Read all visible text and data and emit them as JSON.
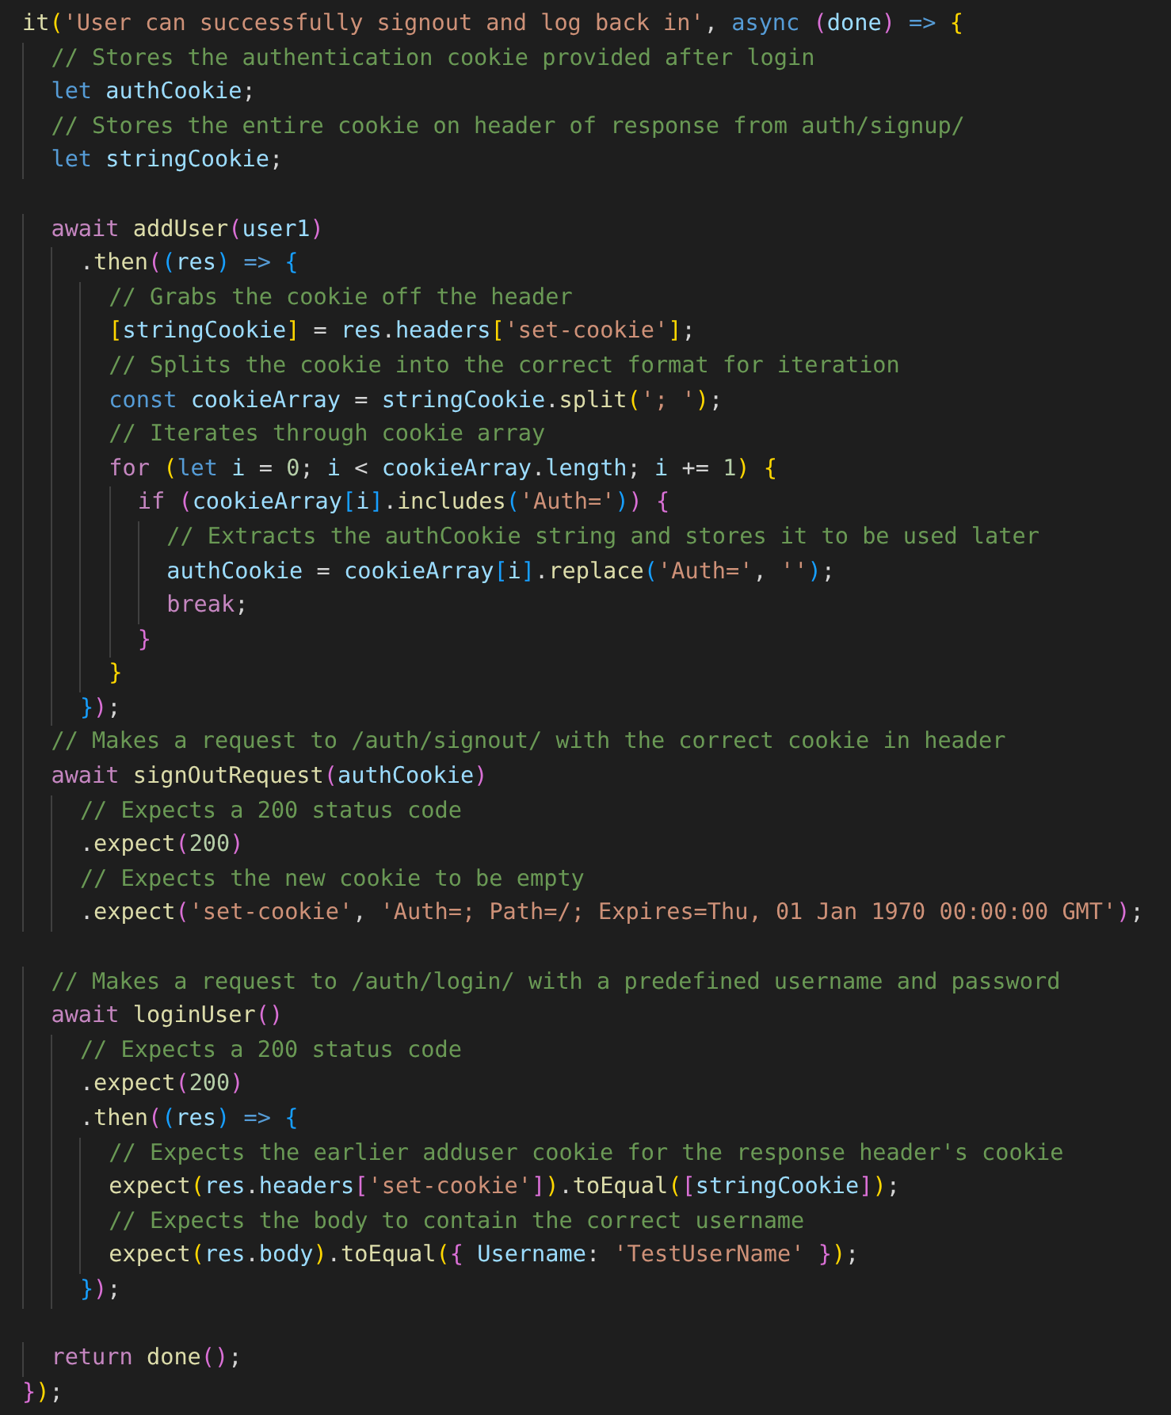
{
  "editor": {
    "lines": [
      {
        "kind": "code",
        "tokens": [
          {
            "kind": "function",
            "text": "it"
          },
          {
            "kind": "bracket1",
            "text": "("
          },
          {
            "kind": "string",
            "text": "'User can successfully signout and log back in'"
          },
          {
            "kind": "plain",
            "text": ", "
          },
          {
            "kind": "keyword",
            "text": "async "
          },
          {
            "kind": "bracket2",
            "text": "("
          },
          {
            "kind": "variable",
            "text": "done"
          },
          {
            "kind": "bracket2",
            "text": ") "
          },
          {
            "kind": "keyword",
            "text": "=> "
          },
          {
            "kind": "bracket1",
            "text": "{"
          }
        ]
      },
      {
        "kind": "code",
        "tokens": [
          {
            "kind": "comment",
            "text": "  // Stores the authentication cookie provided after login"
          }
        ]
      },
      {
        "kind": "code",
        "tokens": [
          {
            "kind": "keyword",
            "text": "  let "
          },
          {
            "kind": "variable",
            "text": "authCookie"
          },
          {
            "kind": "plain",
            "text": ";"
          }
        ]
      },
      {
        "kind": "code",
        "tokens": [
          {
            "kind": "comment",
            "text": "  // Stores the entire cookie on header of response from auth/signup/"
          }
        ]
      },
      {
        "kind": "code",
        "tokens": [
          {
            "kind": "keyword",
            "text": "  let "
          },
          {
            "kind": "variable",
            "text": "stringCookie"
          },
          {
            "kind": "plain",
            "text": ";"
          }
        ]
      },
      {
        "kind": "blank"
      },
      {
        "kind": "code",
        "tokens": [
          {
            "kind": "control",
            "text": "  await "
          },
          {
            "kind": "function",
            "text": "addUser"
          },
          {
            "kind": "bracket2",
            "text": "("
          },
          {
            "kind": "variable",
            "text": "user1"
          },
          {
            "kind": "bracket2",
            "text": ")"
          }
        ]
      },
      {
        "kind": "code",
        "tokens": [
          {
            "kind": "plain",
            "text": "    ."
          },
          {
            "kind": "function",
            "text": "then"
          },
          {
            "kind": "bracket2",
            "text": "("
          },
          {
            "kind": "bracket3",
            "text": "("
          },
          {
            "kind": "variable",
            "text": "res"
          },
          {
            "kind": "bracket3",
            "text": ") "
          },
          {
            "kind": "keyword",
            "text": "=> "
          },
          {
            "kind": "bracket3",
            "text": "{"
          }
        ]
      },
      {
        "kind": "code",
        "tokens": [
          {
            "kind": "comment",
            "text": "      // Grabs the cookie off the header"
          }
        ]
      },
      {
        "kind": "code",
        "tokens": [
          {
            "kind": "bracket1",
            "text": "      ["
          },
          {
            "kind": "variable",
            "text": "stringCookie"
          },
          {
            "kind": "bracket1",
            "text": "]"
          },
          {
            "kind": "plain",
            "text": " = "
          },
          {
            "kind": "variable",
            "text": "res"
          },
          {
            "kind": "plain",
            "text": "."
          },
          {
            "kind": "variable",
            "text": "headers"
          },
          {
            "kind": "bracket1",
            "text": "["
          },
          {
            "kind": "string",
            "text": "'set-cookie'"
          },
          {
            "kind": "bracket1",
            "text": "]"
          },
          {
            "kind": "plain",
            "text": ";"
          }
        ]
      },
      {
        "kind": "code",
        "tokens": [
          {
            "kind": "comment",
            "text": "      // Splits the cookie into the correct format for iteration"
          }
        ]
      },
      {
        "kind": "code",
        "tokens": [
          {
            "kind": "keyword",
            "text": "      const "
          },
          {
            "kind": "variable",
            "text": "cookieArray"
          },
          {
            "kind": "plain",
            "text": " = "
          },
          {
            "kind": "variable",
            "text": "stringCookie"
          },
          {
            "kind": "plain",
            "text": "."
          },
          {
            "kind": "function",
            "text": "split"
          },
          {
            "kind": "bracket1",
            "text": "("
          },
          {
            "kind": "string",
            "text": "'; '"
          },
          {
            "kind": "bracket1",
            "text": ")"
          },
          {
            "kind": "plain",
            "text": ";"
          }
        ]
      },
      {
        "kind": "code",
        "tokens": [
          {
            "kind": "comment",
            "text": "      // Iterates through cookie array"
          }
        ]
      },
      {
        "kind": "code",
        "tokens": [
          {
            "kind": "control",
            "text": "      for "
          },
          {
            "kind": "bracket1",
            "text": "("
          },
          {
            "kind": "keyword",
            "text": "let "
          },
          {
            "kind": "variable",
            "text": "i"
          },
          {
            "kind": "plain",
            "text": " = "
          },
          {
            "kind": "number",
            "text": "0"
          },
          {
            "kind": "plain",
            "text": "; "
          },
          {
            "kind": "variable",
            "text": "i"
          },
          {
            "kind": "plain",
            "text": " < "
          },
          {
            "kind": "variable",
            "text": "cookieArray"
          },
          {
            "kind": "plain",
            "text": "."
          },
          {
            "kind": "variable",
            "text": "length"
          },
          {
            "kind": "plain",
            "text": "; "
          },
          {
            "kind": "variable",
            "text": "i"
          },
          {
            "kind": "plain",
            "text": " += "
          },
          {
            "kind": "number",
            "text": "1"
          },
          {
            "kind": "bracket1",
            "text": ") {"
          }
        ]
      },
      {
        "kind": "code",
        "tokens": [
          {
            "kind": "control",
            "text": "        if "
          },
          {
            "kind": "bracket2",
            "text": "("
          },
          {
            "kind": "variable",
            "text": "cookieArray"
          },
          {
            "kind": "bracket3",
            "text": "["
          },
          {
            "kind": "variable",
            "text": "i"
          },
          {
            "kind": "bracket3",
            "text": "]"
          },
          {
            "kind": "plain",
            "text": "."
          },
          {
            "kind": "function",
            "text": "includes"
          },
          {
            "kind": "bracket3",
            "text": "("
          },
          {
            "kind": "string",
            "text": "'Auth='"
          },
          {
            "kind": "bracket3",
            "text": ")"
          },
          {
            "kind": "bracket2",
            "text": ") {"
          }
        ]
      },
      {
        "kind": "code",
        "tokens": [
          {
            "kind": "comment",
            "text": "          // Extracts the authCookie string and stores it to be used later"
          }
        ]
      },
      {
        "kind": "code",
        "tokens": [
          {
            "kind": "variable",
            "text": "          authCookie"
          },
          {
            "kind": "plain",
            "text": " = "
          },
          {
            "kind": "variable",
            "text": "cookieArray"
          },
          {
            "kind": "bracket3",
            "text": "["
          },
          {
            "kind": "variable",
            "text": "i"
          },
          {
            "kind": "bracket3",
            "text": "]"
          },
          {
            "kind": "plain",
            "text": "."
          },
          {
            "kind": "function",
            "text": "replace"
          },
          {
            "kind": "bracket3",
            "text": "("
          },
          {
            "kind": "string",
            "text": "'Auth='"
          },
          {
            "kind": "plain",
            "text": ", "
          },
          {
            "kind": "string",
            "text": "''"
          },
          {
            "kind": "bracket3",
            "text": ")"
          },
          {
            "kind": "plain",
            "text": ";"
          }
        ]
      },
      {
        "kind": "code",
        "tokens": [
          {
            "kind": "control",
            "text": "          break"
          },
          {
            "kind": "plain",
            "text": ";"
          }
        ]
      },
      {
        "kind": "code",
        "tokens": [
          {
            "kind": "bracket2",
            "text": "        }"
          }
        ]
      },
      {
        "kind": "code",
        "tokens": [
          {
            "kind": "bracket1",
            "text": "      }"
          }
        ]
      },
      {
        "kind": "code",
        "tokens": [
          {
            "kind": "bracket3",
            "text": "    }"
          },
          {
            "kind": "bracket2",
            "text": ")"
          },
          {
            "kind": "plain",
            "text": ";"
          }
        ]
      },
      {
        "kind": "code",
        "tokens": [
          {
            "kind": "comment",
            "text": "  // Makes a request to /auth/signout/ with the correct cookie in header"
          }
        ]
      },
      {
        "kind": "code",
        "tokens": [
          {
            "kind": "control",
            "text": "  await "
          },
          {
            "kind": "function",
            "text": "signOutRequest"
          },
          {
            "kind": "bracket2",
            "text": "("
          },
          {
            "kind": "variable",
            "text": "authCookie"
          },
          {
            "kind": "bracket2",
            "text": ")"
          }
        ]
      },
      {
        "kind": "code",
        "tokens": [
          {
            "kind": "comment",
            "text": "    // Expects a 200 status code"
          }
        ]
      },
      {
        "kind": "code",
        "tokens": [
          {
            "kind": "plain",
            "text": "    ."
          },
          {
            "kind": "function",
            "text": "expect"
          },
          {
            "kind": "bracket2",
            "text": "("
          },
          {
            "kind": "number",
            "text": "200"
          },
          {
            "kind": "bracket2",
            "text": ")"
          }
        ]
      },
      {
        "kind": "code",
        "tokens": [
          {
            "kind": "comment",
            "text": "    // Expects the new cookie to be empty"
          }
        ]
      },
      {
        "kind": "code",
        "tokens": [
          {
            "kind": "plain",
            "text": "    ."
          },
          {
            "kind": "function",
            "text": "expect"
          },
          {
            "kind": "bracket2",
            "text": "("
          },
          {
            "kind": "string",
            "text": "'set-cookie'"
          },
          {
            "kind": "plain",
            "text": ", "
          },
          {
            "kind": "string",
            "text": "'Auth=; Path=/; Expires=Thu, 01 Jan 1970 00:00:00 GMT'"
          },
          {
            "kind": "bracket2",
            "text": ")"
          },
          {
            "kind": "plain",
            "text": ";"
          }
        ]
      },
      {
        "kind": "blank"
      },
      {
        "kind": "code",
        "tokens": [
          {
            "kind": "comment",
            "text": "  // Makes a request to /auth/login/ with a predefined username and password"
          }
        ]
      },
      {
        "kind": "code",
        "tokens": [
          {
            "kind": "control",
            "text": "  await "
          },
          {
            "kind": "function",
            "text": "loginUser"
          },
          {
            "kind": "bracket2",
            "text": "()"
          }
        ]
      },
      {
        "kind": "code",
        "tokens": [
          {
            "kind": "comment",
            "text": "    // Expects a 200 status code"
          }
        ]
      },
      {
        "kind": "code",
        "tokens": [
          {
            "kind": "plain",
            "text": "    ."
          },
          {
            "kind": "function",
            "text": "expect"
          },
          {
            "kind": "bracket2",
            "text": "("
          },
          {
            "kind": "number",
            "text": "200"
          },
          {
            "kind": "bracket2",
            "text": ")"
          }
        ]
      },
      {
        "kind": "code",
        "tokens": [
          {
            "kind": "plain",
            "text": "    ."
          },
          {
            "kind": "function",
            "text": "then"
          },
          {
            "kind": "bracket2",
            "text": "("
          },
          {
            "kind": "bracket3",
            "text": "("
          },
          {
            "kind": "variable",
            "text": "res"
          },
          {
            "kind": "bracket3",
            "text": ") "
          },
          {
            "kind": "keyword",
            "text": "=> "
          },
          {
            "kind": "bracket3",
            "text": "{"
          }
        ]
      },
      {
        "kind": "code",
        "tokens": [
          {
            "kind": "comment",
            "text": "      // Expects the earlier adduser cookie for the response header's cookie"
          }
        ]
      },
      {
        "kind": "code",
        "tokens": [
          {
            "kind": "function",
            "text": "      expect"
          },
          {
            "kind": "bracket1",
            "text": "("
          },
          {
            "kind": "variable",
            "text": "res"
          },
          {
            "kind": "plain",
            "text": "."
          },
          {
            "kind": "variable",
            "text": "headers"
          },
          {
            "kind": "bracket2",
            "text": "["
          },
          {
            "kind": "string",
            "text": "'set-cookie'"
          },
          {
            "kind": "bracket2",
            "text": "]"
          },
          {
            "kind": "bracket1",
            "text": ")"
          },
          {
            "kind": "plain",
            "text": "."
          },
          {
            "kind": "function",
            "text": "toEqual"
          },
          {
            "kind": "bracket1",
            "text": "("
          },
          {
            "kind": "bracket2",
            "text": "["
          },
          {
            "kind": "variable",
            "text": "stringCookie"
          },
          {
            "kind": "bracket2",
            "text": "]"
          },
          {
            "kind": "bracket1",
            "text": ")"
          },
          {
            "kind": "plain",
            "text": ";"
          }
        ]
      },
      {
        "kind": "code",
        "tokens": [
          {
            "kind": "comment",
            "text": "      // Expects the body to contain the correct username"
          }
        ]
      },
      {
        "kind": "code",
        "tokens": [
          {
            "kind": "function",
            "text": "      expect"
          },
          {
            "kind": "bracket1",
            "text": "("
          },
          {
            "kind": "variable",
            "text": "res"
          },
          {
            "kind": "plain",
            "text": "."
          },
          {
            "kind": "variable",
            "text": "body"
          },
          {
            "kind": "bracket1",
            "text": ")"
          },
          {
            "kind": "plain",
            "text": "."
          },
          {
            "kind": "function",
            "text": "toEqual"
          },
          {
            "kind": "bracket1",
            "text": "("
          },
          {
            "kind": "bracket2",
            "text": "{ "
          },
          {
            "kind": "variable",
            "text": "Username"
          },
          {
            "kind": "plain",
            "text": ": "
          },
          {
            "kind": "string",
            "text": "'TestUserName'"
          },
          {
            "kind": "bracket2",
            "text": " }"
          },
          {
            "kind": "bracket1",
            "text": ")"
          },
          {
            "kind": "plain",
            "text": ";"
          }
        ]
      },
      {
        "kind": "code",
        "tokens": [
          {
            "kind": "bracket3",
            "text": "    }"
          },
          {
            "kind": "bracket2",
            "text": ")"
          },
          {
            "kind": "plain",
            "text": ";"
          }
        ]
      },
      {
        "kind": "blank"
      },
      {
        "kind": "code",
        "tokens": [
          {
            "kind": "control",
            "text": "  return "
          },
          {
            "kind": "function",
            "text": "done"
          },
          {
            "kind": "bracket2",
            "text": "()"
          },
          {
            "kind": "plain",
            "text": ";"
          }
        ]
      },
      {
        "kind": "code",
        "tokens": [
          {
            "kind": "bracket2",
            "text": "}"
          },
          {
            "kind": "bracket1",
            "text": ")"
          },
          {
            "kind": "plain",
            "text": ";"
          }
        ]
      }
    ]
  }
}
